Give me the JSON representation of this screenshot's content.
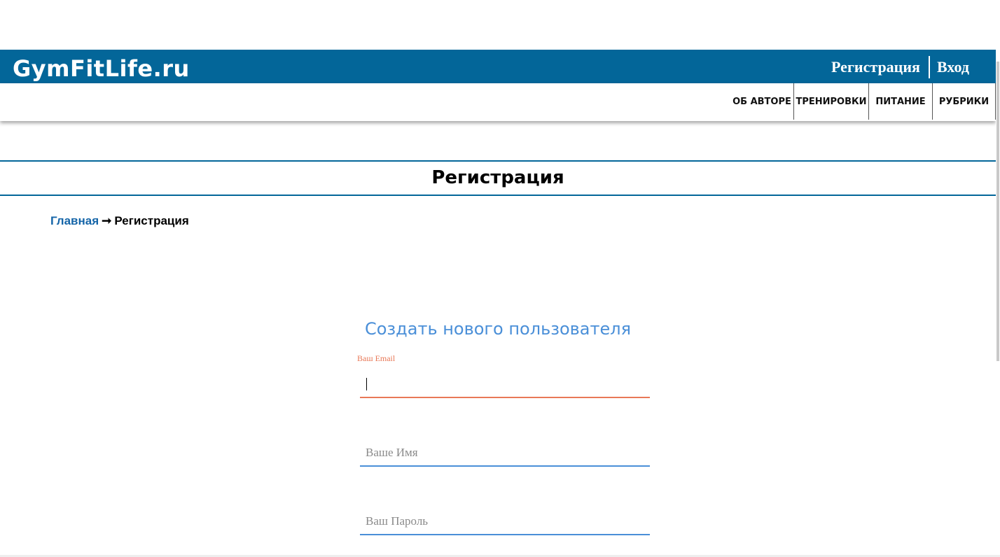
{
  "header": {
    "logo": "GymFitLife.ru",
    "auth_links": {
      "register": "Регистрация",
      "login": "Вход"
    },
    "brand_color": "#036699"
  },
  "nav": {
    "items": [
      {
        "label": "ОБ АВТОРЕ"
      },
      {
        "label": "ТРЕНИРОВКИ"
      },
      {
        "label": "ПИТАНИЕ"
      },
      {
        "label": "РУБРИКИ"
      }
    ]
  },
  "page": {
    "title": "Регистрация"
  },
  "breadcrumb": {
    "home": "Главная",
    "arrow": "➞",
    "current": "Регистрация"
  },
  "form": {
    "title": "Создать нового пользователя",
    "email": {
      "label": "Ваш Email",
      "value": ""
    },
    "name": {
      "placeholder": "Ваше Имя",
      "value": ""
    },
    "password": {
      "placeholder": "Ваш Пароль",
      "value": ""
    },
    "accent_color": "#4a8fd8",
    "active_color": "#e87857"
  }
}
